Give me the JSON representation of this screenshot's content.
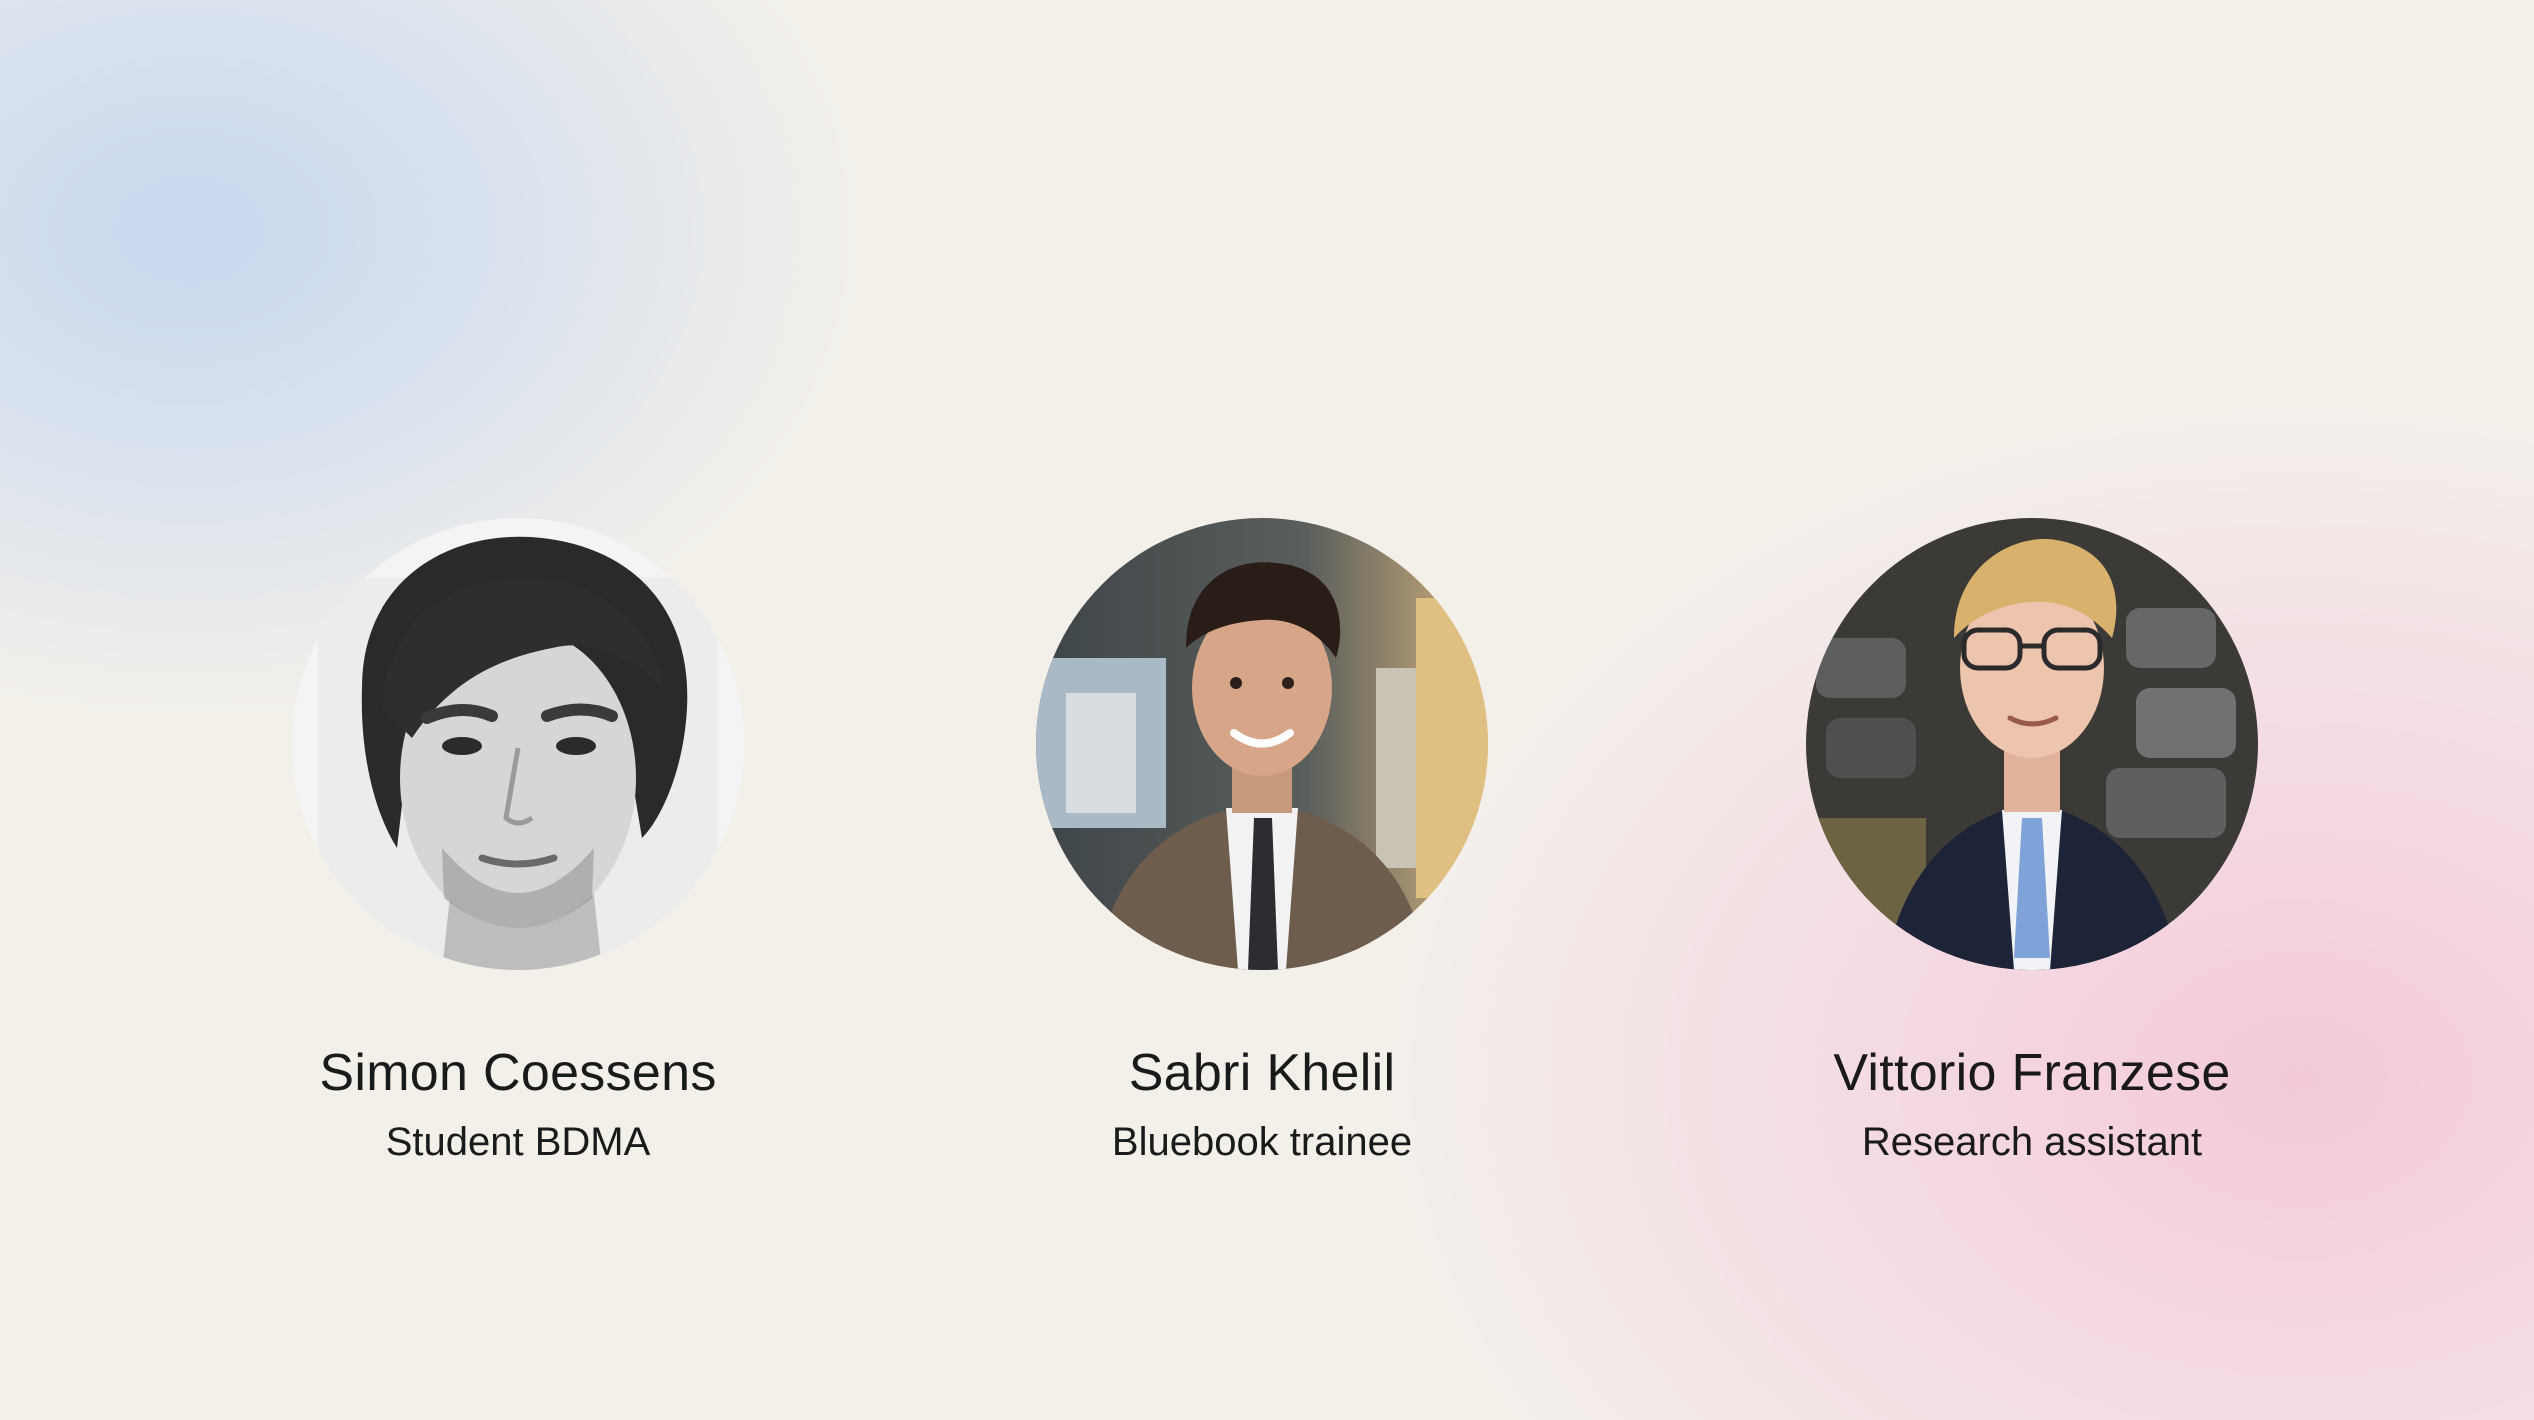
{
  "team": {
    "members": [
      {
        "name": "Simon Coessens",
        "role": "Student BDMA",
        "photo": "portrait-photo-grayscale"
      },
      {
        "name": "Sabri Khelil",
        "role": "Bluebook trainee",
        "photo": "portrait-photo-office"
      },
      {
        "name": "Vittorio Franzese",
        "role": "Research assistant",
        "photo": "portrait-photo-lecture-hall"
      }
    ]
  }
}
